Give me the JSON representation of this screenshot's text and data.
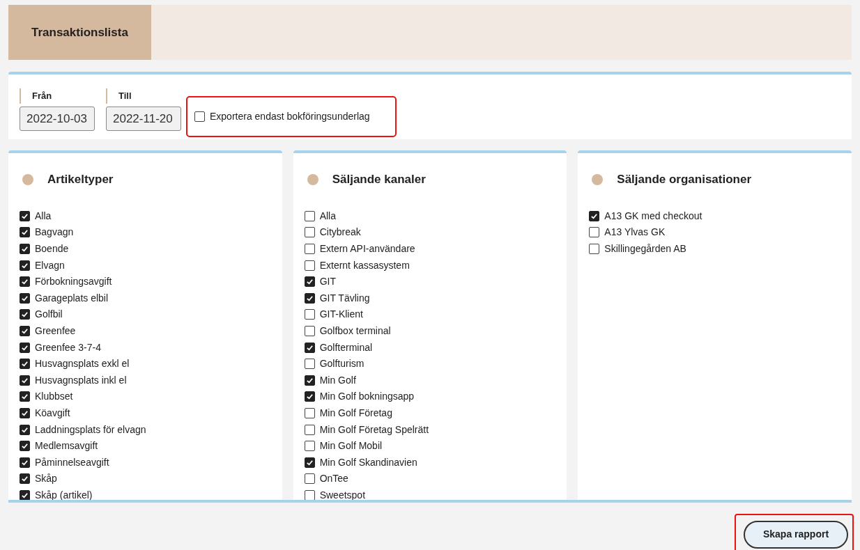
{
  "header": {
    "title": "Transaktionslista"
  },
  "filters": {
    "from": {
      "label": "Från",
      "value": "2022-10-03"
    },
    "to": {
      "label": "Till",
      "value": "2022-11-20"
    },
    "export_only": {
      "label": "Exportera endast bokföringsunderlag",
      "checked": false
    }
  },
  "panels": [
    {
      "title": "Artikeltyper",
      "items": [
        {
          "label": "Alla",
          "checked": true
        },
        {
          "label": "Bagvagn",
          "checked": true
        },
        {
          "label": "Boende",
          "checked": true
        },
        {
          "label": "Elvagn",
          "checked": true
        },
        {
          "label": "Förbokningsavgift",
          "checked": true
        },
        {
          "label": "Garageplats elbil",
          "checked": true
        },
        {
          "label": "Golfbil",
          "checked": true
        },
        {
          "label": "Greenfee",
          "checked": true
        },
        {
          "label": "Greenfee 3-7-4",
          "checked": true
        },
        {
          "label": "Husvagnsplats exkl el",
          "checked": true
        },
        {
          "label": "Husvagnsplats inkl el",
          "checked": true
        },
        {
          "label": "Klubbset",
          "checked": true
        },
        {
          "label": "Köavgift",
          "checked": true
        },
        {
          "label": "Laddningsplats för elvagn",
          "checked": true
        },
        {
          "label": "Medlemsavgift",
          "checked": true
        },
        {
          "label": "Påminnelseavgift",
          "checked": true
        },
        {
          "label": "Skåp",
          "checked": true
        },
        {
          "label": "Skåp (artikel)",
          "checked": true
        }
      ]
    },
    {
      "title": "Säljande kanaler",
      "items": [
        {
          "label": "Alla",
          "checked": false
        },
        {
          "label": "Citybreak",
          "checked": false
        },
        {
          "label": "Extern API-användare",
          "checked": false
        },
        {
          "label": "Externt kassasystem",
          "checked": false
        },
        {
          "label": "GIT",
          "checked": true
        },
        {
          "label": "GIT Tävling",
          "checked": true
        },
        {
          "label": "GIT-Klient",
          "checked": false
        },
        {
          "label": "Golfbox terminal",
          "checked": false
        },
        {
          "label": "Golfterminal",
          "checked": true
        },
        {
          "label": "Golfturism",
          "checked": false
        },
        {
          "label": "Min Golf",
          "checked": true
        },
        {
          "label": "Min Golf bokningsapp",
          "checked": true
        },
        {
          "label": "Min Golf Företag",
          "checked": false
        },
        {
          "label": "Min Golf Företag Spelrätt",
          "checked": false
        },
        {
          "label": "Min Golf Mobil",
          "checked": false
        },
        {
          "label": "Min Golf Skandinavien",
          "checked": true
        },
        {
          "label": "OnTee",
          "checked": false
        },
        {
          "label": "Sweetspot",
          "checked": false
        }
      ]
    },
    {
      "title": "Säljande organisationer",
      "items": [
        {
          "label": "A13 GK med checkout",
          "checked": true
        },
        {
          "label": "A13 Ylvas GK",
          "checked": false
        },
        {
          "label": "Skillingegården AB",
          "checked": false
        }
      ]
    }
  ],
  "actions": {
    "create_report": "Skapa rapport"
  }
}
